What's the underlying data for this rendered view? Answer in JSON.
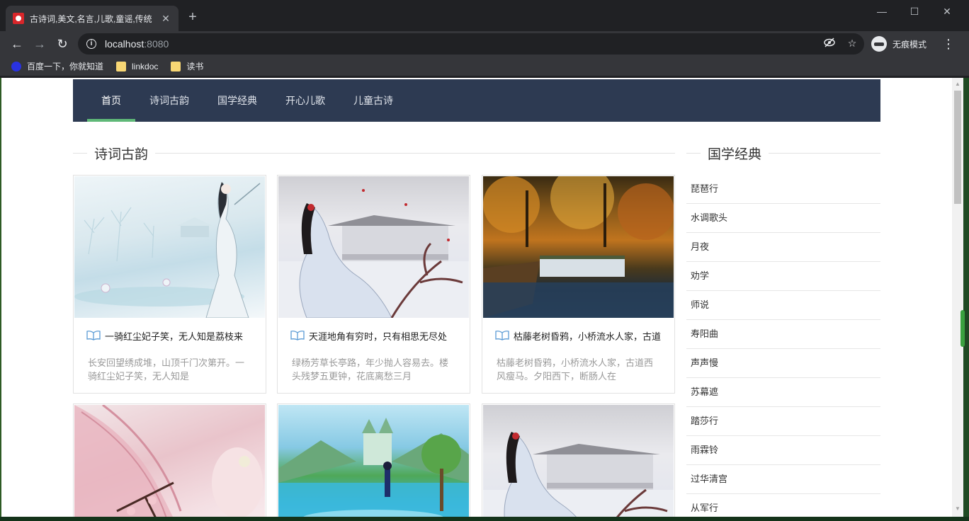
{
  "browser": {
    "tab_title": "古诗词,美文,名言,儿歌,童谣,传统",
    "tab_close": "✕",
    "new_tab": "+",
    "window_controls": {
      "minimize": "—",
      "maximize": "☐",
      "close": "✕"
    },
    "nav": {
      "back": "←",
      "forward": "→",
      "reload": "↻"
    },
    "url_host": "localhost",
    "url_port": ":8080",
    "incognito_label": "无痕模式",
    "menu": "⋮",
    "bookmarks": [
      {
        "label": "百度一下，你就知道",
        "icon": "baidu-icon"
      },
      {
        "label": "linkdoc",
        "icon": "folder-icon"
      },
      {
        "label": "读书",
        "icon": "folder-icon"
      }
    ]
  },
  "nav": {
    "items": [
      "首页",
      "诗词古韵",
      "国学经典",
      "开心儿歌",
      "儿童古诗"
    ],
    "active_index": 0
  },
  "sections": {
    "poetry": "诗词古韵",
    "classics": "国学经典"
  },
  "cards": [
    {
      "title": "一骑红尘妃子笑，无人知是荔枝来",
      "excerpt": "长安回望绣成堆，山顶千门次第开。一骑红尘妃子笑，无人知是",
      "art": "snow-palace"
    },
    {
      "title": "天涯地角有穷时，只有相思无尽处",
      "excerpt": "绿杨芳草长亭路，年少抛人容易去。楼头残梦五更钟，花底离愁三月",
      "art": "red-flower-lady"
    },
    {
      "title": "枯藤老树昏鸦，小桥流水人家，古道",
      "excerpt": "枯藤老树昏鸦，小桥流水人家，古道西风瘦马。夕阳西下，断肠人在",
      "art": "autumn-waterfall"
    },
    {
      "title": "",
      "excerpt": "",
      "art": "pink-hair-blossom"
    },
    {
      "title": "",
      "excerpt": "",
      "art": "castle-lake"
    },
    {
      "title": "",
      "excerpt": "",
      "art": "red-flower-lady"
    }
  ],
  "sidebar": {
    "items": [
      "琵琶行",
      "水调歌头",
      "月夜",
      "劝学",
      "师说",
      "寿阳曲",
      "声声慢",
      "苏幕遮",
      "踏莎行",
      "雨霖铃",
      "过华清宫",
      "从军行"
    ]
  },
  "colors": {
    "nav_bg": "#2d3a52",
    "nav_active_underline": "#5fb878",
    "book_icon": "#5b9bd5"
  }
}
